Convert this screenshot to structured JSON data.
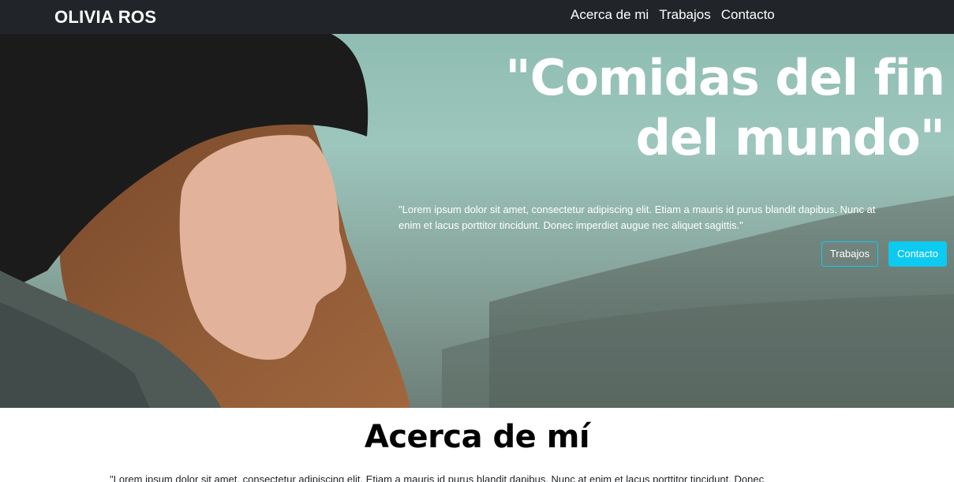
{
  "nav": {
    "brand": "OLIVIA ROS",
    "links": [
      "Acerca de mi",
      "Trabajos",
      "Contacto"
    ]
  },
  "hero": {
    "title_line1": "\"Comidas del fin",
    "title_line2": "del mundo\"",
    "quote": "\"Lorem ipsum dolor sit amet, consectetur adipiscing elit. Etiam a mauris id purus blandit dapibus. Nunc at enim et lacus porttitor tincidunt. Donec imperdiet augue nec aliquet sagittis.\"",
    "button_outline": "Trabajos",
    "button_solid": "Contacto"
  },
  "about": {
    "title": "Acerca de mí",
    "text": "\"Lorem ipsum dolor sit amet, consectetur adipiscing elit. Etiam a mauris id purus blandit dapibus. Nunc at enim et lacus porttitor tincidunt. Donec"
  },
  "colors": {
    "navbar": "#212529",
    "accent": "#0dcaf0",
    "hero_teal": "#9dc6bc"
  }
}
